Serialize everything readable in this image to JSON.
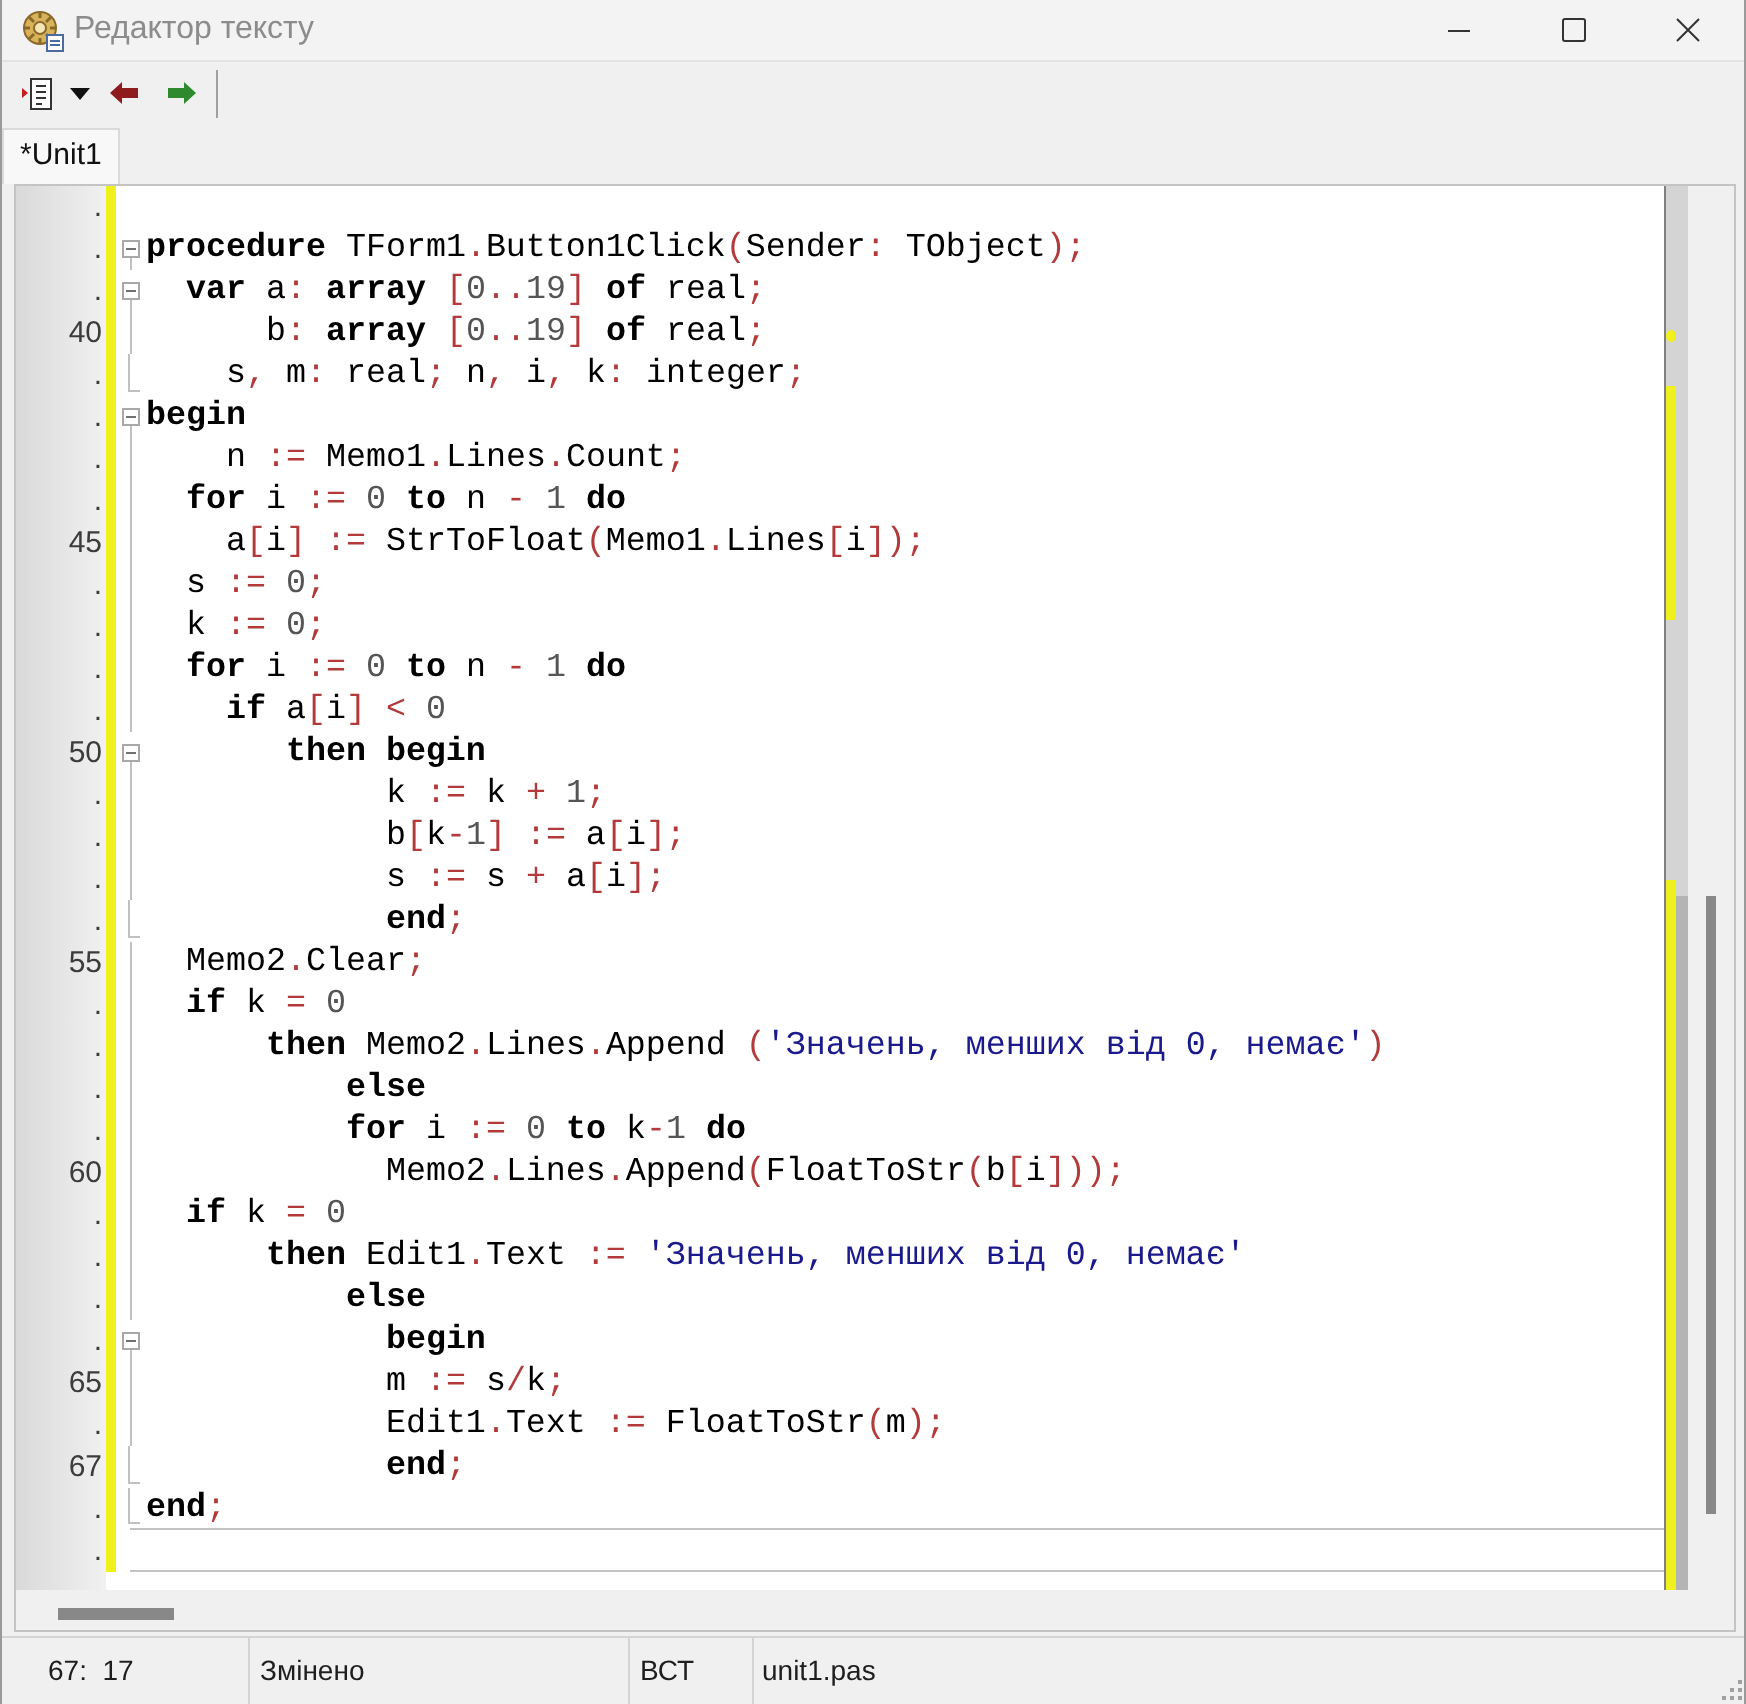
{
  "window": {
    "title": "Редактор тексту"
  },
  "tabs": [
    {
      "label": "*Unit1",
      "selected": true
    }
  ],
  "editor": {
    "lines": [
      {
        "number": ".",
        "kind": "plain",
        "modified": true,
        "divider": false
      },
      {
        "number": ".",
        "kind": "fold-open",
        "modified": true,
        "divider": false,
        "tokens": [
          {
            "kind": "keyword",
            "text": "procedure"
          },
          {
            "kind": "identifier",
            "text": " TForm1"
          },
          {
            "kind": "symbol",
            "text": "."
          },
          {
            "kind": "identifier",
            "text": "Button1Click"
          },
          {
            "kind": "symbol",
            "text": "("
          },
          {
            "kind": "identifier",
            "text": "Sender"
          },
          {
            "kind": "symbol",
            "text": ":"
          },
          {
            "kind": "identifier",
            "text": " TObject"
          },
          {
            "kind": "symbol",
            "text": ");"
          }
        ]
      },
      {
        "number": ".",
        "kind": "fold-open",
        "modified": true,
        "divider": false,
        "tokens": [
          {
            "kind": "keyword",
            "text": "  var"
          },
          {
            "kind": "identifier",
            "text": " a"
          },
          {
            "kind": "symbol",
            "text": ":"
          },
          {
            "kind": "keyword",
            "text": " array"
          },
          {
            "kind": "symbol",
            "text": " ["
          },
          {
            "kind": "number",
            "text": "0"
          },
          {
            "kind": "symbol",
            "text": ".."
          },
          {
            "kind": "number",
            "text": "19"
          },
          {
            "kind": "symbol",
            "text": "]"
          },
          {
            "kind": "keyword",
            "text": " of"
          },
          {
            "kind": "identifier",
            "text": " real"
          },
          {
            "kind": "symbol",
            "text": ";"
          }
        ]
      },
      {
        "number": "40",
        "kind": "fold-body",
        "modified": true,
        "divider": false,
        "tokens": [
          {
            "kind": "identifier",
            "text": "      b"
          },
          {
            "kind": "symbol",
            "text": ":"
          },
          {
            "kind": "keyword",
            "text": " array"
          },
          {
            "kind": "symbol",
            "text": " ["
          },
          {
            "kind": "number",
            "text": "0"
          },
          {
            "kind": "symbol",
            "text": ".."
          },
          {
            "kind": "number",
            "text": "19"
          },
          {
            "kind": "symbol",
            "text": "]"
          },
          {
            "kind": "keyword",
            "text": " of"
          },
          {
            "kind": "identifier",
            "text": " real"
          },
          {
            "kind": "symbol",
            "text": ";"
          }
        ]
      },
      {
        "number": ".",
        "kind": "fold-end",
        "modified": true,
        "divider": false,
        "tokens": [
          {
            "kind": "identifier",
            "text": "    s"
          },
          {
            "kind": "symbol",
            "text": ","
          },
          {
            "kind": "identifier",
            "text": " m"
          },
          {
            "kind": "symbol",
            "text": ":"
          },
          {
            "kind": "identifier",
            "text": " real"
          },
          {
            "kind": "symbol",
            "text": ";"
          },
          {
            "kind": "identifier",
            "text": " n"
          },
          {
            "kind": "symbol",
            "text": ","
          },
          {
            "kind": "identifier",
            "text": " i"
          },
          {
            "kind": "symbol",
            "text": ","
          },
          {
            "kind": "identifier",
            "text": " k"
          },
          {
            "kind": "symbol",
            "text": ":"
          },
          {
            "kind": "identifier",
            "text": " integer"
          },
          {
            "kind": "symbol",
            "text": ";"
          }
        ]
      },
      {
        "number": ".",
        "kind": "fold-open",
        "modified": true,
        "divider": false,
        "tokens": [
          {
            "kind": "keyword",
            "text": "begin"
          }
        ]
      },
      {
        "number": ".",
        "kind": "fold-body",
        "modified": true,
        "divider": false,
        "tokens": [
          {
            "kind": "identifier",
            "text": "    n"
          },
          {
            "kind": "symbol",
            "text": " :="
          },
          {
            "kind": "identifier",
            "text": " Memo1"
          },
          {
            "kind": "symbol",
            "text": "."
          },
          {
            "kind": "identifier",
            "text": "Lines"
          },
          {
            "kind": "symbol",
            "text": "."
          },
          {
            "kind": "identifier",
            "text": "Count"
          },
          {
            "kind": "symbol",
            "text": ";"
          }
        ]
      },
      {
        "number": ".",
        "kind": "fold-body",
        "modified": true,
        "divider": false,
        "tokens": [
          {
            "kind": "keyword",
            "text": "  for"
          },
          {
            "kind": "identifier",
            "text": " i"
          },
          {
            "kind": "symbol",
            "text": " :="
          },
          {
            "kind": "number",
            "text": " 0"
          },
          {
            "kind": "keyword",
            "text": " to"
          },
          {
            "kind": "identifier",
            "text": " n"
          },
          {
            "kind": "symbol",
            "text": " -"
          },
          {
            "kind": "number",
            "text": " 1"
          },
          {
            "kind": "keyword",
            "text": " do"
          }
        ]
      },
      {
        "number": "45",
        "kind": "fold-body",
        "modified": true,
        "divider": false,
        "tokens": [
          {
            "kind": "identifier",
            "text": "    a"
          },
          {
            "kind": "symbol",
            "text": "["
          },
          {
            "kind": "identifier",
            "text": "i"
          },
          {
            "kind": "symbol",
            "text": "] :="
          },
          {
            "kind": "identifier",
            "text": " StrToFloat"
          },
          {
            "kind": "symbol",
            "text": "("
          },
          {
            "kind": "identifier",
            "text": "Memo1"
          },
          {
            "kind": "symbol",
            "text": "."
          },
          {
            "kind": "identifier",
            "text": "Lines"
          },
          {
            "kind": "symbol",
            "text": "["
          },
          {
            "kind": "identifier",
            "text": "i"
          },
          {
            "kind": "symbol",
            "text": "]);"
          }
        ]
      },
      {
        "number": ".",
        "kind": "fold-body",
        "modified": true,
        "divider": false,
        "tokens": [
          {
            "kind": "identifier",
            "text": "  s"
          },
          {
            "kind": "symbol",
            "text": " :="
          },
          {
            "kind": "number",
            "text": " 0"
          },
          {
            "kind": "symbol",
            "text": ";"
          }
        ]
      },
      {
        "number": ".",
        "kind": "fold-body",
        "modified": true,
        "divider": false,
        "tokens": [
          {
            "kind": "identifier",
            "text": "  k"
          },
          {
            "kind": "symbol",
            "text": " :="
          },
          {
            "kind": "number",
            "text": " 0"
          },
          {
            "kind": "symbol",
            "text": ";"
          }
        ]
      },
      {
        "number": ".",
        "kind": "fold-body",
        "modified": true,
        "divider": false,
        "tokens": [
          {
            "kind": "keyword",
            "text": "  for"
          },
          {
            "kind": "identifier",
            "text": " i"
          },
          {
            "kind": "symbol",
            "text": " :="
          },
          {
            "kind": "number",
            "text": " 0"
          },
          {
            "kind": "keyword",
            "text": " to"
          },
          {
            "kind": "identifier",
            "text": " n"
          },
          {
            "kind": "symbol",
            "text": " -"
          },
          {
            "kind": "number",
            "text": " 1"
          },
          {
            "kind": "keyword",
            "text": " do"
          }
        ]
      },
      {
        "number": ".",
        "kind": "fold-body",
        "modified": true,
        "divider": false,
        "tokens": [
          {
            "kind": "keyword",
            "text": "    if"
          },
          {
            "kind": "identifier",
            "text": " a"
          },
          {
            "kind": "symbol",
            "text": "["
          },
          {
            "kind": "identifier",
            "text": "i"
          },
          {
            "kind": "symbol",
            "text": "] <"
          },
          {
            "kind": "number",
            "text": " 0"
          }
        ]
      },
      {
        "number": "50",
        "kind": "fold-open",
        "modified": true,
        "divider": false,
        "tokens": [
          {
            "kind": "keyword",
            "text": "       then begin"
          }
        ]
      },
      {
        "number": ".",
        "kind": "fold-body",
        "modified": true,
        "divider": false,
        "tokens": [
          {
            "kind": "identifier",
            "text": "            k"
          },
          {
            "kind": "symbol",
            "text": " :="
          },
          {
            "kind": "identifier",
            "text": " k"
          },
          {
            "kind": "symbol",
            "text": " +"
          },
          {
            "kind": "number",
            "text": " 1"
          },
          {
            "kind": "symbol",
            "text": ";"
          }
        ]
      },
      {
        "number": ".",
        "kind": "fold-body",
        "modified": true,
        "divider": false,
        "tokens": [
          {
            "kind": "identifier",
            "text": "            b"
          },
          {
            "kind": "symbol",
            "text": "["
          },
          {
            "kind": "identifier",
            "text": "k"
          },
          {
            "kind": "symbol",
            "text": "-"
          },
          {
            "kind": "number",
            "text": "1"
          },
          {
            "kind": "symbol",
            "text": "] :="
          },
          {
            "kind": "identifier",
            "text": " a"
          },
          {
            "kind": "symbol",
            "text": "["
          },
          {
            "kind": "identifier",
            "text": "i"
          },
          {
            "kind": "symbol",
            "text": "];"
          }
        ]
      },
      {
        "number": ".",
        "kind": "fold-body",
        "modified": true,
        "divider": false,
        "tokens": [
          {
            "kind": "identifier",
            "text": "            s"
          },
          {
            "kind": "symbol",
            "text": " :="
          },
          {
            "kind": "identifier",
            "text": " s"
          },
          {
            "kind": "symbol",
            "text": " +"
          },
          {
            "kind": "identifier",
            "text": " a"
          },
          {
            "kind": "symbol",
            "text": "["
          },
          {
            "kind": "identifier",
            "text": "i"
          },
          {
            "kind": "symbol",
            "text": "];"
          }
        ]
      },
      {
        "number": ".",
        "kind": "fold-end",
        "modified": true,
        "divider": false,
        "tokens": [
          {
            "kind": "keyword",
            "text": "            end"
          },
          {
            "kind": "symbol",
            "text": ";"
          }
        ]
      },
      {
        "number": "55",
        "kind": "fold-body",
        "modified": true,
        "divider": false,
        "tokens": [
          {
            "kind": "identifier",
            "text": "  Memo2"
          },
          {
            "kind": "symbol",
            "text": "."
          },
          {
            "kind": "identifier",
            "text": "Clear"
          },
          {
            "kind": "symbol",
            "text": ";"
          }
        ]
      },
      {
        "number": ".",
        "kind": "fold-body",
        "modified": true,
        "divider": false,
        "tokens": [
          {
            "kind": "keyword",
            "text": "  if"
          },
          {
            "kind": "identifier",
            "text": " k"
          },
          {
            "kind": "symbol",
            "text": " ="
          },
          {
            "kind": "number",
            "text": " 0"
          }
        ]
      },
      {
        "number": ".",
        "kind": "fold-body",
        "modified": true,
        "divider": false,
        "tokens": [
          {
            "kind": "keyword",
            "text": "      then"
          },
          {
            "kind": "identifier",
            "text": " Memo2"
          },
          {
            "kind": "symbol",
            "text": "."
          },
          {
            "kind": "identifier",
            "text": "Lines"
          },
          {
            "kind": "symbol",
            "text": "."
          },
          {
            "kind": "identifier",
            "text": "Append"
          },
          {
            "kind": "symbol",
            "text": " ("
          },
          {
            "kind": "string",
            "text": "'Значень, менших від 0, немає'"
          },
          {
            "kind": "symbol",
            "text": ")"
          }
        ]
      },
      {
        "number": ".",
        "kind": "fold-body",
        "modified": true,
        "divider": false,
        "tokens": [
          {
            "kind": "keyword",
            "text": "          else"
          }
        ]
      },
      {
        "number": ".",
        "kind": "fold-body",
        "modified": true,
        "divider": false,
        "tokens": [
          {
            "kind": "keyword",
            "text": "          for"
          },
          {
            "kind": "identifier",
            "text": " i"
          },
          {
            "kind": "symbol",
            "text": " :="
          },
          {
            "kind": "number",
            "text": " 0"
          },
          {
            "kind": "keyword",
            "text": " to"
          },
          {
            "kind": "identifier",
            "text": " k"
          },
          {
            "kind": "symbol",
            "text": "-"
          },
          {
            "kind": "number",
            "text": "1"
          },
          {
            "kind": "keyword",
            "text": " do"
          }
        ]
      },
      {
        "number": "60",
        "kind": "fold-body",
        "modified": true,
        "divider": false,
        "tokens": [
          {
            "kind": "identifier",
            "text": "            Memo2"
          },
          {
            "kind": "symbol",
            "text": "."
          },
          {
            "kind": "identifier",
            "text": "Lines"
          },
          {
            "kind": "symbol",
            "text": "."
          },
          {
            "kind": "identifier",
            "text": "Append"
          },
          {
            "kind": "symbol",
            "text": "("
          },
          {
            "kind": "identifier",
            "text": "FloatToStr"
          },
          {
            "kind": "symbol",
            "text": "("
          },
          {
            "kind": "identifier",
            "text": "b"
          },
          {
            "kind": "symbol",
            "text": "["
          },
          {
            "kind": "identifier",
            "text": "i"
          },
          {
            "kind": "symbol",
            "text": "]));"
          }
        ]
      },
      {
        "number": ".",
        "kind": "fold-body",
        "modified": true,
        "divider": false,
        "tokens": [
          {
            "kind": "keyword",
            "text": "  if"
          },
          {
            "kind": "identifier",
            "text": " k"
          },
          {
            "kind": "symbol",
            "text": " ="
          },
          {
            "kind": "number",
            "text": " 0"
          }
        ]
      },
      {
        "number": ".",
        "kind": "fold-body",
        "modified": true,
        "divider": false,
        "tokens": [
          {
            "kind": "keyword",
            "text": "      then"
          },
          {
            "kind": "identifier",
            "text": " Edit1"
          },
          {
            "kind": "symbol",
            "text": "."
          },
          {
            "kind": "identifier",
            "text": "Text"
          },
          {
            "kind": "symbol",
            "text": " :="
          },
          {
            "kind": "string",
            "text": " 'Значень, менших від 0, немає'"
          }
        ]
      },
      {
        "number": ".",
        "kind": "fold-body",
        "modified": true,
        "divider": false,
        "tokens": [
          {
            "kind": "keyword",
            "text": "          else"
          }
        ]
      },
      {
        "number": ".",
        "kind": "fold-open",
        "modified": true,
        "divider": false,
        "tokens": [
          {
            "kind": "keyword",
            "text": "            begin"
          }
        ]
      },
      {
        "number": "65",
        "kind": "fold-body",
        "modified": true,
        "divider": false,
        "tokens": [
          {
            "kind": "identifier",
            "text": "            m"
          },
          {
            "kind": "symbol",
            "text": " :="
          },
          {
            "kind": "identifier",
            "text": " s"
          },
          {
            "kind": "symbol",
            "text": "/"
          },
          {
            "kind": "identifier",
            "text": "k"
          },
          {
            "kind": "symbol",
            "text": ";"
          }
        ]
      },
      {
        "number": ".",
        "kind": "fold-body",
        "modified": true,
        "divider": false,
        "tokens": [
          {
            "kind": "identifier",
            "text": "            Edit1"
          },
          {
            "kind": "symbol",
            "text": "."
          },
          {
            "kind": "identifier",
            "text": "Text"
          },
          {
            "kind": "symbol",
            "text": " :="
          },
          {
            "kind": "identifier",
            "text": " FloatToStr"
          },
          {
            "kind": "symbol",
            "text": "("
          },
          {
            "kind": "identifier",
            "text": "m"
          },
          {
            "kind": "symbol",
            "text": ");"
          }
        ]
      },
      {
        "number": "67",
        "kind": "fold-end",
        "modified": true,
        "divider": false,
        "tokens": [
          {
            "kind": "keyword",
            "text": "            end"
          },
          {
            "kind": "symbol",
            "text": ";"
          }
        ]
      },
      {
        "number": ".",
        "kind": "fold-end",
        "modified": true,
        "divider": true,
        "tokens": [
          {
            "kind": "keyword",
            "text": "end"
          },
          {
            "kind": "symbol",
            "text": ";"
          }
        ]
      },
      {
        "number": ".",
        "kind": "plain",
        "modified": true,
        "divider": true
      }
    ]
  },
  "status_bar": {
    "cursor": "67:  17",
    "state": "Змінено",
    "mode": "ВСТ",
    "file": "unit1.pas"
  }
}
